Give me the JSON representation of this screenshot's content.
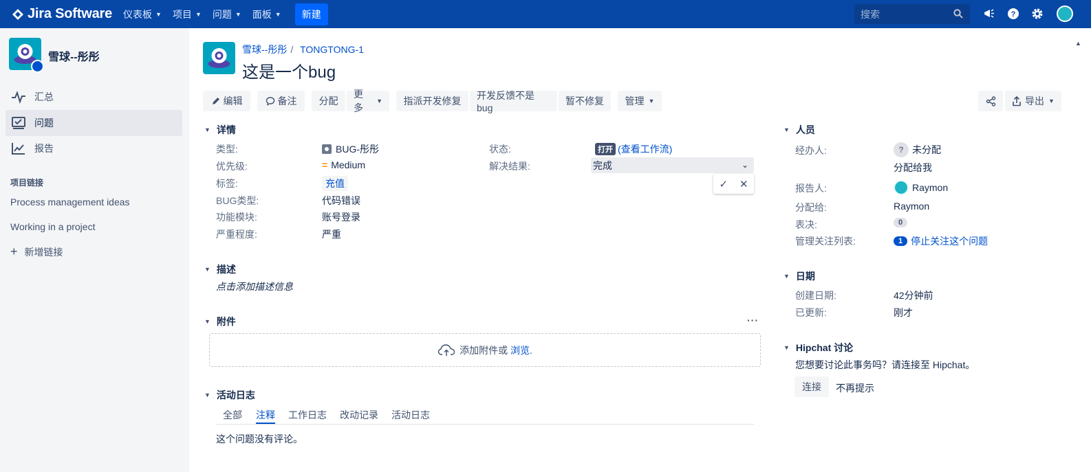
{
  "topnav": {
    "brand": "Jira Software",
    "menus": [
      {
        "label": "仪表板"
      },
      {
        "label": "项目"
      },
      {
        "label": "问题"
      },
      {
        "label": "面板"
      }
    ],
    "create_label": "新建",
    "search_placeholder": "搜索"
  },
  "sidebar": {
    "project_name": "雪球--彤彤",
    "items": [
      {
        "label": "汇总"
      },
      {
        "label": "问题"
      },
      {
        "label": "报告"
      }
    ],
    "links_heading": "项目链接",
    "links": [
      "Process management ideas",
      "Working in a project"
    ],
    "add_link_label": "新增链接"
  },
  "issue": {
    "breadcrumb_project": "雪球--彤彤",
    "breadcrumb_key": "TONGTONG-1",
    "title": "这是一个bug"
  },
  "toolbar": {
    "edit": "编辑",
    "comment": "备注",
    "assign": "分配",
    "more": "更多",
    "assign_dev_fix": "指派开发修复",
    "dev_feedback_not_bug": "开发反馈不是bug",
    "wont_fix": "暂不修复",
    "manage": "管理",
    "export": "导出"
  },
  "details": {
    "section_title": "详情",
    "type_label": "类型:",
    "type_value": "BUG-彤彤",
    "priority_label": "优先级:",
    "priority_value": "Medium",
    "tags_label": "标签:",
    "tags_value": "充值",
    "bug_type_label": "BUG类型:",
    "bug_type_value": "代码错误",
    "module_label": "功能模块:",
    "module_value": "账号登录",
    "severity_label": "严重程度:",
    "severity_value": "严重",
    "status_label": "状态:",
    "status_value": "打开",
    "view_workflow": "(查看工作流)",
    "resolution_label": "解决结果:",
    "resolution_value": "完成"
  },
  "description": {
    "section_title": "描述",
    "placeholder": "点击添加描述信息"
  },
  "attachments": {
    "section_title": "附件",
    "drop_text": "添加附件或",
    "browse_link": "浏览."
  },
  "activity": {
    "section_title": "活动日志",
    "tabs": [
      {
        "label": "全部"
      },
      {
        "label": "注释"
      },
      {
        "label": "工作日志"
      },
      {
        "label": "改动记录"
      },
      {
        "label": "活动日志"
      }
    ],
    "active_tab": "注释",
    "empty_text": "这个问题没有评论。"
  },
  "people": {
    "section_title": "人员",
    "assignee_label": "经办人:",
    "assignee_value": "未分配",
    "assign_to_me": "分配给我",
    "reporter_label": "报告人:",
    "reporter_value": "Raymon",
    "assigned_to_label": "分配给:",
    "assigned_to_value": "Raymon",
    "votes_label": "表决:",
    "votes_value": "0",
    "watchers_label": "管理关注列表:",
    "watchers_count": "1",
    "stop_watching": "停止关注这个问题"
  },
  "dates": {
    "section_title": "日期",
    "created_label": "创建日期:",
    "created_value": "42分钟前",
    "updated_label": "已更新:",
    "updated_value": "刚才"
  },
  "hipchat": {
    "section_title": "Hipchat 讨论",
    "prompt": "您想要讨论此事务吗？请连接至 Hipchat。",
    "connect": "连接",
    "dismiss": "不再提示"
  },
  "colors": {
    "nav_bg": "#0747a6",
    "create_btn": "#0065ff",
    "link": "#0052cc",
    "sidebar_bg": "#f4f5f7",
    "priority_medium": "#ff8b00",
    "status_lozenge": "#42526e"
  }
}
